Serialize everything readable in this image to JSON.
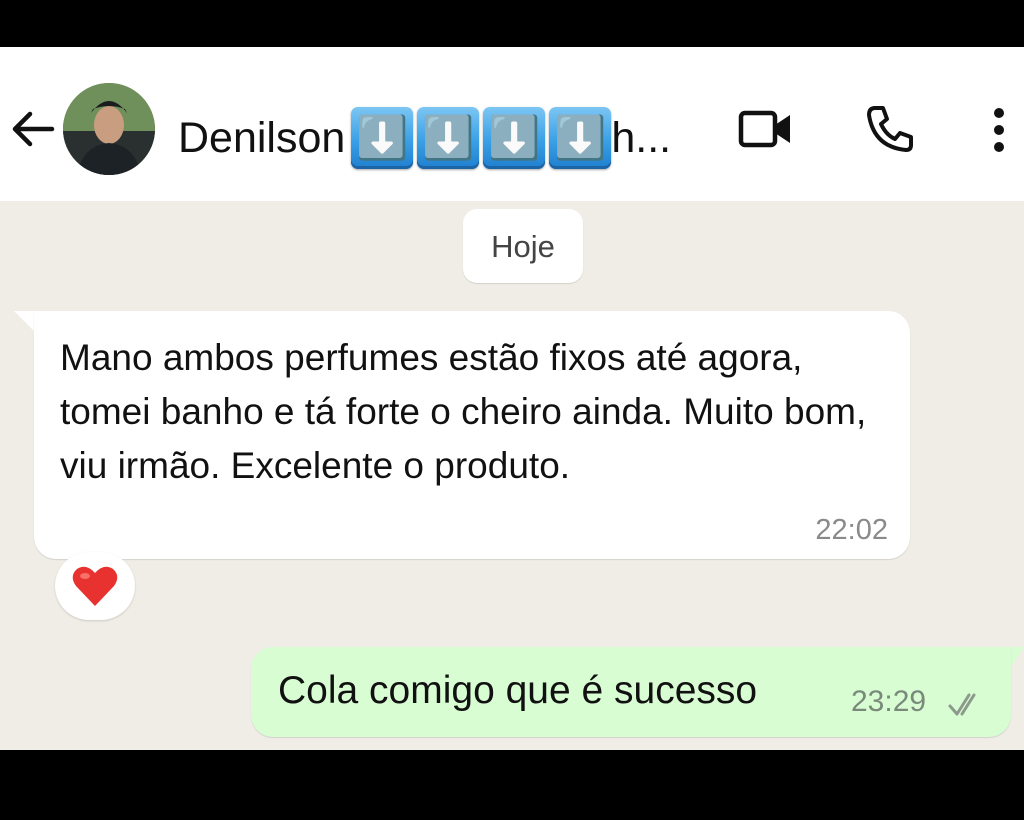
{
  "header": {
    "contact_name": "Denilson",
    "name_emojis": [
      "⬇️",
      "⬇️",
      "⬇️",
      "⬇️"
    ],
    "name_suffix": "h...",
    "icons": {
      "back": "back-arrow-icon",
      "video": "video-call-icon",
      "call": "phone-icon",
      "menu": "more-options-icon"
    }
  },
  "chat": {
    "day_label": "Hoje",
    "messages": [
      {
        "direction": "incoming",
        "text": "Mano ambos perfumes estão fixos até agora, tomei banho e tá forte o cheiro ainda. Muito bom, viu irmão. Excelente o produto.",
        "time": "22:02",
        "reaction": "❤️"
      },
      {
        "direction": "outgoing",
        "text": "Cola comigo que é sucesso",
        "time": "23:29",
        "status": "read-check-icon"
      }
    ]
  },
  "colors": {
    "header_bg": "#ffffff",
    "chat_bg": "#f0ede6",
    "incoming_bubble": "#ffffff",
    "outgoing_bubble": "#d9fdd3",
    "emoji_blue": "#3aa0e6",
    "heart_red": "#e8322f"
  }
}
